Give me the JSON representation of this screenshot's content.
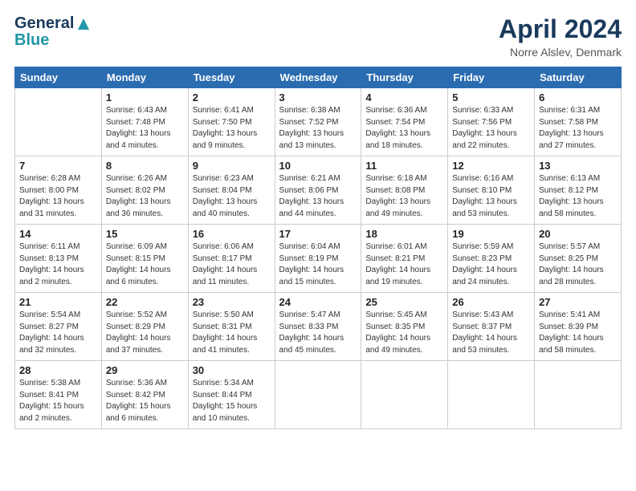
{
  "header": {
    "logo_line1": "General",
    "logo_line2": "Blue",
    "month": "April 2024",
    "location": "Norre Alslev, Denmark"
  },
  "weekdays": [
    "Sunday",
    "Monday",
    "Tuesday",
    "Wednesday",
    "Thursday",
    "Friday",
    "Saturday"
  ],
  "weeks": [
    [
      {
        "day": "",
        "sunrise": "",
        "sunset": "",
        "daylight": ""
      },
      {
        "day": "1",
        "sunrise": "6:43 AM",
        "sunset": "7:48 PM",
        "daylight": "13 hours and 4 minutes."
      },
      {
        "day": "2",
        "sunrise": "6:41 AM",
        "sunset": "7:50 PM",
        "daylight": "13 hours and 9 minutes."
      },
      {
        "day": "3",
        "sunrise": "6:38 AM",
        "sunset": "7:52 PM",
        "daylight": "13 hours and 13 minutes."
      },
      {
        "day": "4",
        "sunrise": "6:36 AM",
        "sunset": "7:54 PM",
        "daylight": "13 hours and 18 minutes."
      },
      {
        "day": "5",
        "sunrise": "6:33 AM",
        "sunset": "7:56 PM",
        "daylight": "13 hours and 22 minutes."
      },
      {
        "day": "6",
        "sunrise": "6:31 AM",
        "sunset": "7:58 PM",
        "daylight": "13 hours and 27 minutes."
      }
    ],
    [
      {
        "day": "7",
        "sunrise": "6:28 AM",
        "sunset": "8:00 PM",
        "daylight": "13 hours and 31 minutes."
      },
      {
        "day": "8",
        "sunrise": "6:26 AM",
        "sunset": "8:02 PM",
        "daylight": "13 hours and 36 minutes."
      },
      {
        "day": "9",
        "sunrise": "6:23 AM",
        "sunset": "8:04 PM",
        "daylight": "13 hours and 40 minutes."
      },
      {
        "day": "10",
        "sunrise": "6:21 AM",
        "sunset": "8:06 PM",
        "daylight": "13 hours and 44 minutes."
      },
      {
        "day": "11",
        "sunrise": "6:18 AM",
        "sunset": "8:08 PM",
        "daylight": "13 hours and 49 minutes."
      },
      {
        "day": "12",
        "sunrise": "6:16 AM",
        "sunset": "8:10 PM",
        "daylight": "13 hours and 53 minutes."
      },
      {
        "day": "13",
        "sunrise": "6:13 AM",
        "sunset": "8:12 PM",
        "daylight": "13 hours and 58 minutes."
      }
    ],
    [
      {
        "day": "14",
        "sunrise": "6:11 AM",
        "sunset": "8:13 PM",
        "daylight": "14 hours and 2 minutes."
      },
      {
        "day": "15",
        "sunrise": "6:09 AM",
        "sunset": "8:15 PM",
        "daylight": "14 hours and 6 minutes."
      },
      {
        "day": "16",
        "sunrise": "6:06 AM",
        "sunset": "8:17 PM",
        "daylight": "14 hours and 11 minutes."
      },
      {
        "day": "17",
        "sunrise": "6:04 AM",
        "sunset": "8:19 PM",
        "daylight": "14 hours and 15 minutes."
      },
      {
        "day": "18",
        "sunrise": "6:01 AM",
        "sunset": "8:21 PM",
        "daylight": "14 hours and 19 minutes."
      },
      {
        "day": "19",
        "sunrise": "5:59 AM",
        "sunset": "8:23 PM",
        "daylight": "14 hours and 24 minutes."
      },
      {
        "day": "20",
        "sunrise": "5:57 AM",
        "sunset": "8:25 PM",
        "daylight": "14 hours and 28 minutes."
      }
    ],
    [
      {
        "day": "21",
        "sunrise": "5:54 AM",
        "sunset": "8:27 PM",
        "daylight": "14 hours and 32 minutes."
      },
      {
        "day": "22",
        "sunrise": "5:52 AM",
        "sunset": "8:29 PM",
        "daylight": "14 hours and 37 minutes."
      },
      {
        "day": "23",
        "sunrise": "5:50 AM",
        "sunset": "8:31 PM",
        "daylight": "14 hours and 41 minutes."
      },
      {
        "day": "24",
        "sunrise": "5:47 AM",
        "sunset": "8:33 PM",
        "daylight": "14 hours and 45 minutes."
      },
      {
        "day": "25",
        "sunrise": "5:45 AM",
        "sunset": "8:35 PM",
        "daylight": "14 hours and 49 minutes."
      },
      {
        "day": "26",
        "sunrise": "5:43 AM",
        "sunset": "8:37 PM",
        "daylight": "14 hours and 53 minutes."
      },
      {
        "day": "27",
        "sunrise": "5:41 AM",
        "sunset": "8:39 PM",
        "daylight": "14 hours and 58 minutes."
      }
    ],
    [
      {
        "day": "28",
        "sunrise": "5:38 AM",
        "sunset": "8:41 PM",
        "daylight": "15 hours and 2 minutes."
      },
      {
        "day": "29",
        "sunrise": "5:36 AM",
        "sunset": "8:42 PM",
        "daylight": "15 hours and 6 minutes."
      },
      {
        "day": "30",
        "sunrise": "5:34 AM",
        "sunset": "8:44 PM",
        "daylight": "15 hours and 10 minutes."
      },
      {
        "day": "",
        "sunrise": "",
        "sunset": "",
        "daylight": ""
      },
      {
        "day": "",
        "sunrise": "",
        "sunset": "",
        "daylight": ""
      },
      {
        "day": "",
        "sunrise": "",
        "sunset": "",
        "daylight": ""
      },
      {
        "day": "",
        "sunrise": "",
        "sunset": "",
        "daylight": ""
      }
    ]
  ],
  "labels": {
    "sunrise": "Sunrise: ",
    "sunset": "Sunset: ",
    "daylight": "Daylight: "
  }
}
